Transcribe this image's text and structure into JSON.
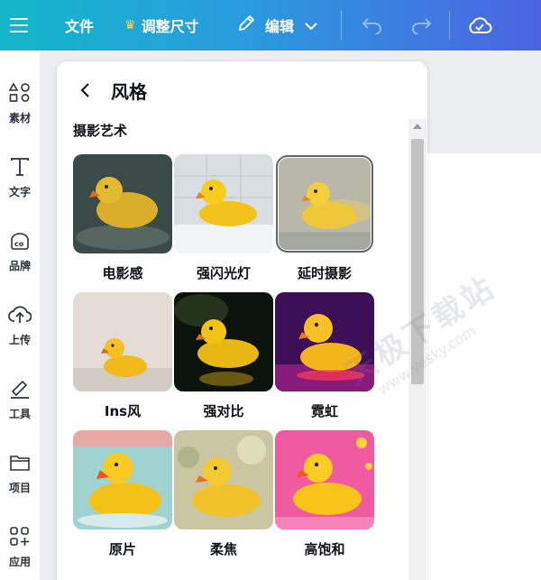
{
  "toolbar": {
    "file_label": "文件",
    "resize_label": "调整尺寸",
    "edit_label": "编辑",
    "accent_start": "#12b7c9",
    "accent_end": "#4b64e0",
    "icons": [
      "menu-icon",
      "crown-icon",
      "pen-icon",
      "chevron-down-icon",
      "undo-icon",
      "redo-icon",
      "cloud-check-icon"
    ]
  },
  "sidebar": {
    "items": [
      {
        "label": "素材",
        "icon": "shapes-icon"
      },
      {
        "label": "文字",
        "icon": "text-icon"
      },
      {
        "label": "品牌",
        "icon": "brand-icon"
      },
      {
        "label": "上传",
        "icon": "upload-cloud-icon"
      },
      {
        "label": "工具",
        "icon": "tools-icon"
      },
      {
        "label": "项目",
        "icon": "folder-icon"
      },
      {
        "label": "应用",
        "icon": "apps-icon"
      }
    ]
  },
  "panel": {
    "title": "风格",
    "section_title": "摄影艺术",
    "styles": [
      {
        "label": "电影感"
      },
      {
        "label": "强闪光灯"
      },
      {
        "label": "延时摄影",
        "selected": true
      },
      {
        "label": "Ins风"
      },
      {
        "label": "强对比"
      },
      {
        "label": "霓虹"
      },
      {
        "label": "原片"
      },
      {
        "label": "柔焦"
      },
      {
        "label": "高饱和"
      }
    ]
  },
  "watermark": {
    "text": "天极下载站",
    "sub": "www.yesky.com"
  }
}
